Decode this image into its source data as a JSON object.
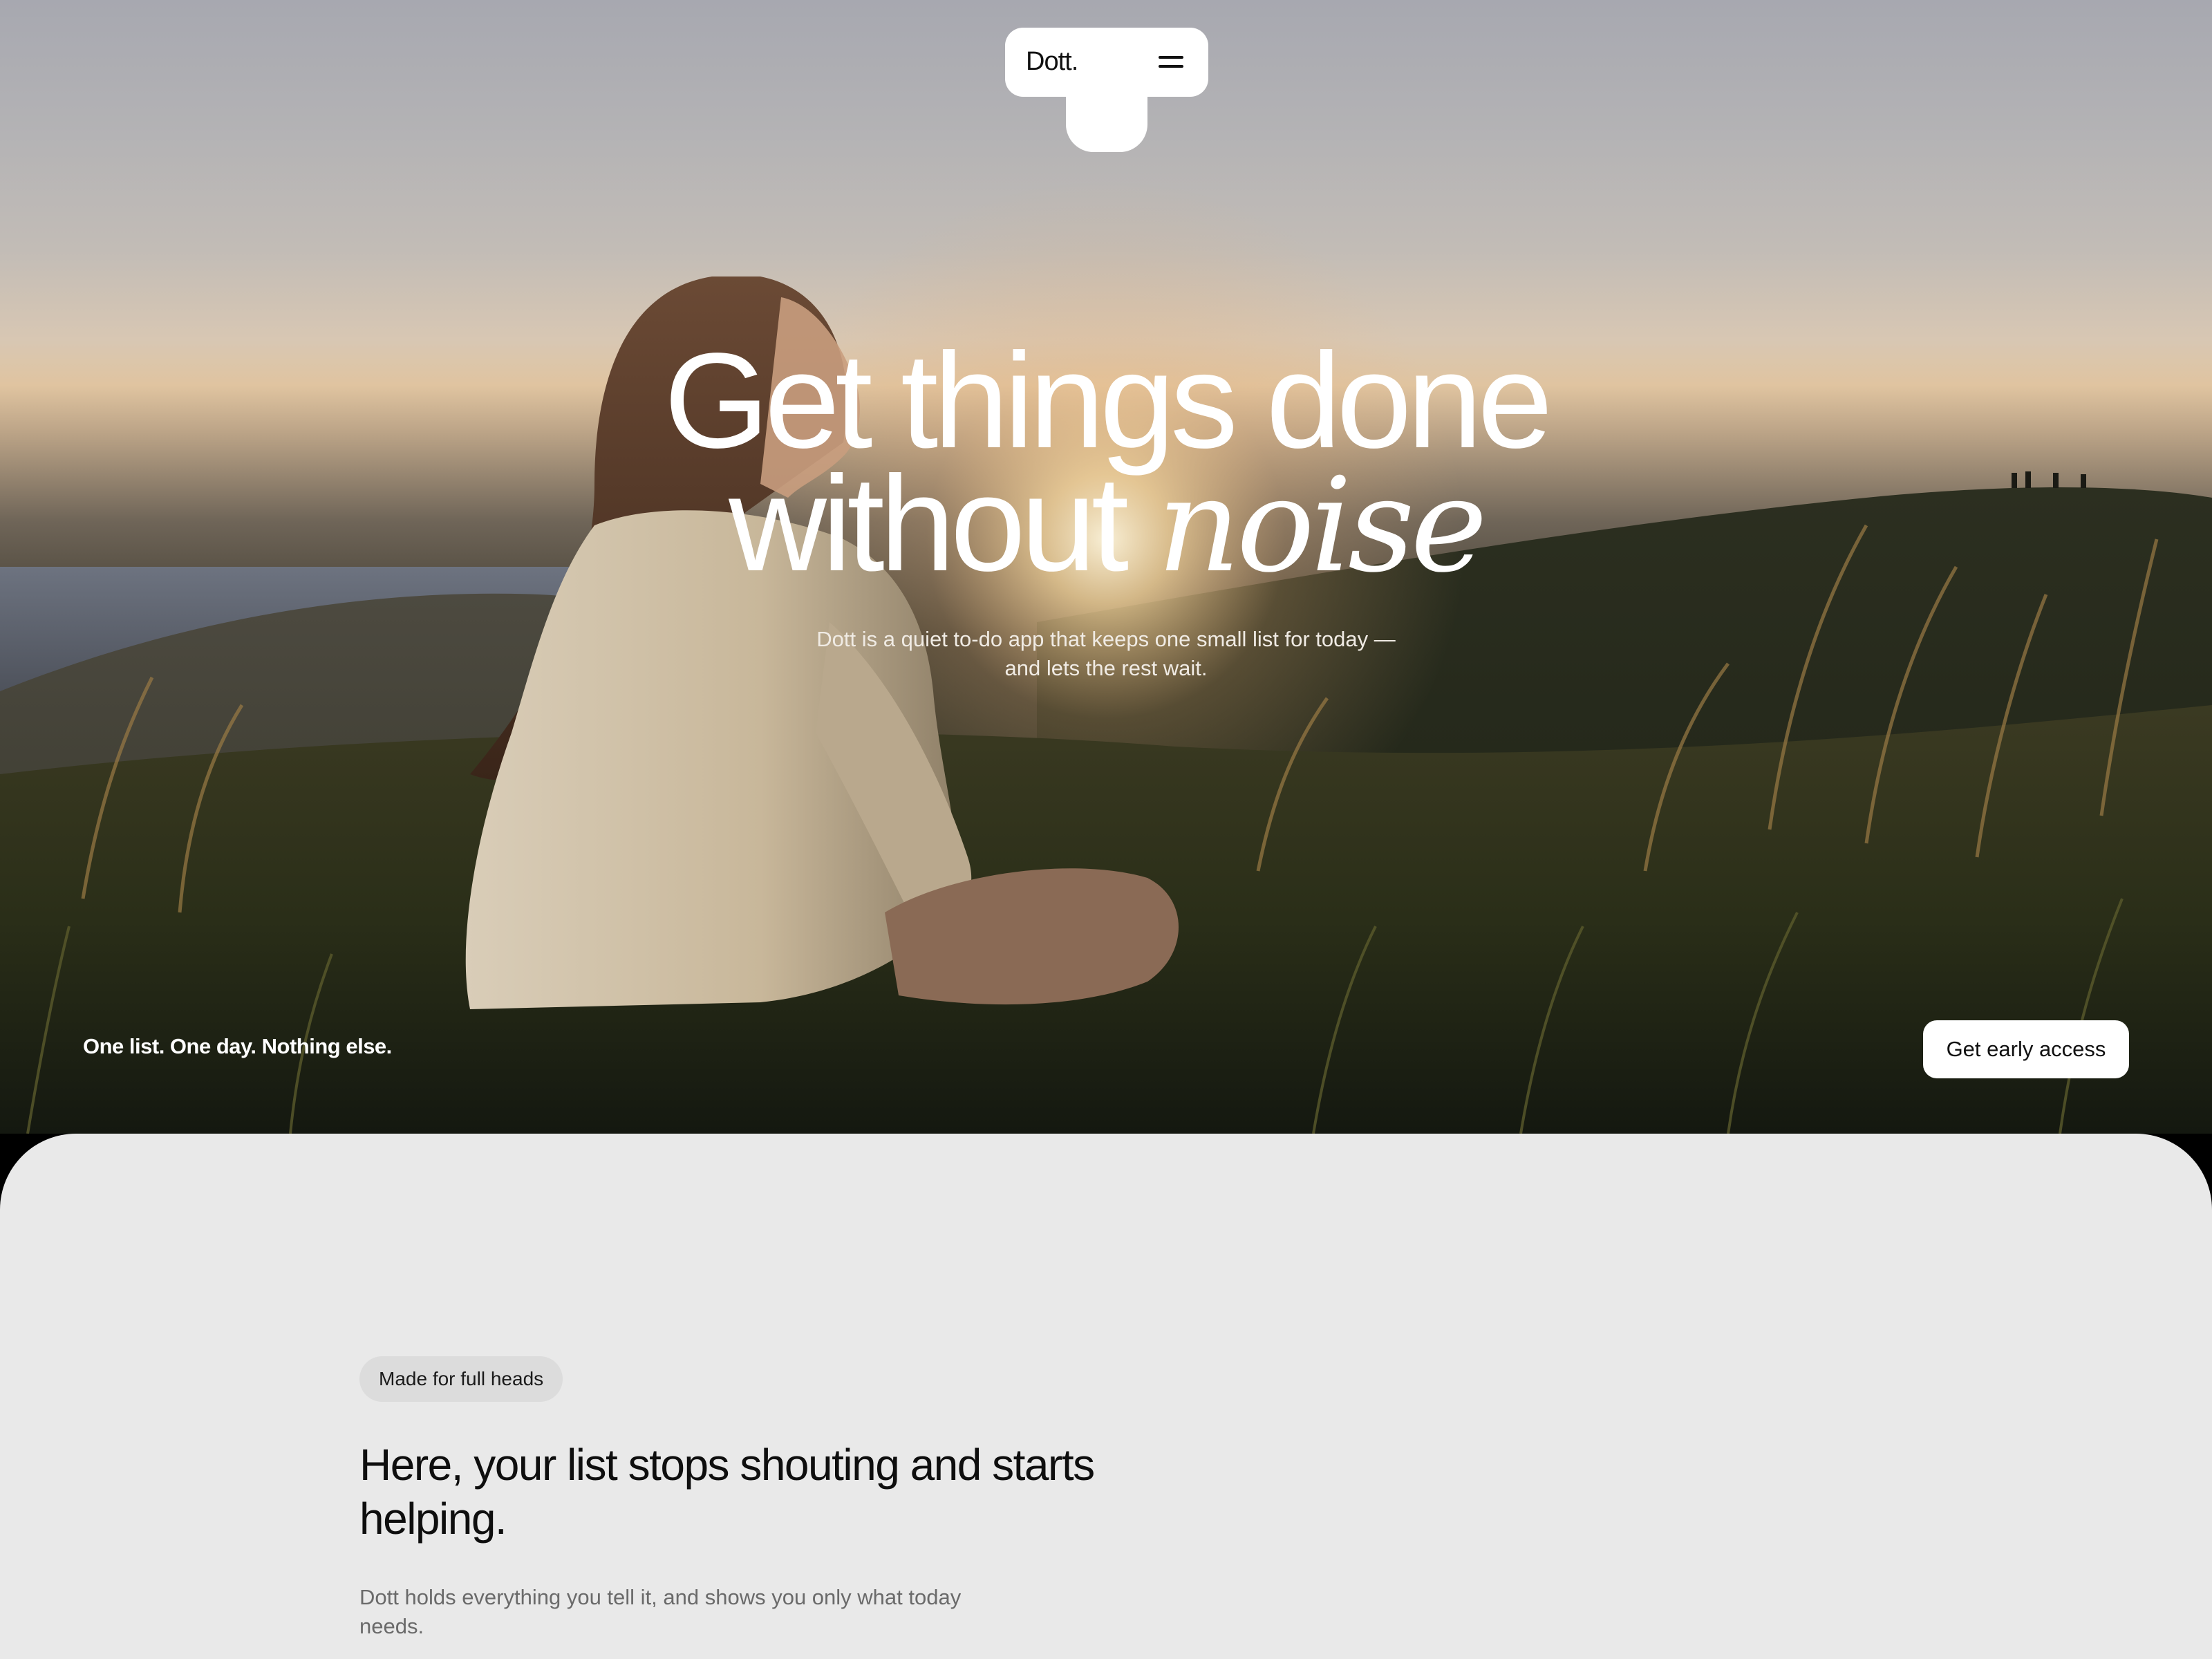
{
  "nav": {
    "logo": "Dott.",
    "menu_icon": "hamburger-menu-icon"
  },
  "hero": {
    "headline_line1": "Get things done",
    "headline_line2_plain": "without",
    "headline_line2_accent": "noise",
    "subtitle_line1": "Dott is a quiet to-do app that keeps one small list for today —",
    "subtitle_line2": "and lets the rest wait.",
    "tagline": "One list. One day. Nothing else.",
    "cta_label": "Get early access"
  },
  "intro": {
    "badge": "Made for full heads",
    "title": "Here, your list stops shouting and starts helping.",
    "body": "Dott holds everything you tell it, and shows you only what today needs."
  },
  "colors": {
    "section_bg": "#e9e9e9",
    "text_dark": "#0e0e0e",
    "text_muted": "#6a6a6a",
    "pill_bg": "#ffffff"
  }
}
